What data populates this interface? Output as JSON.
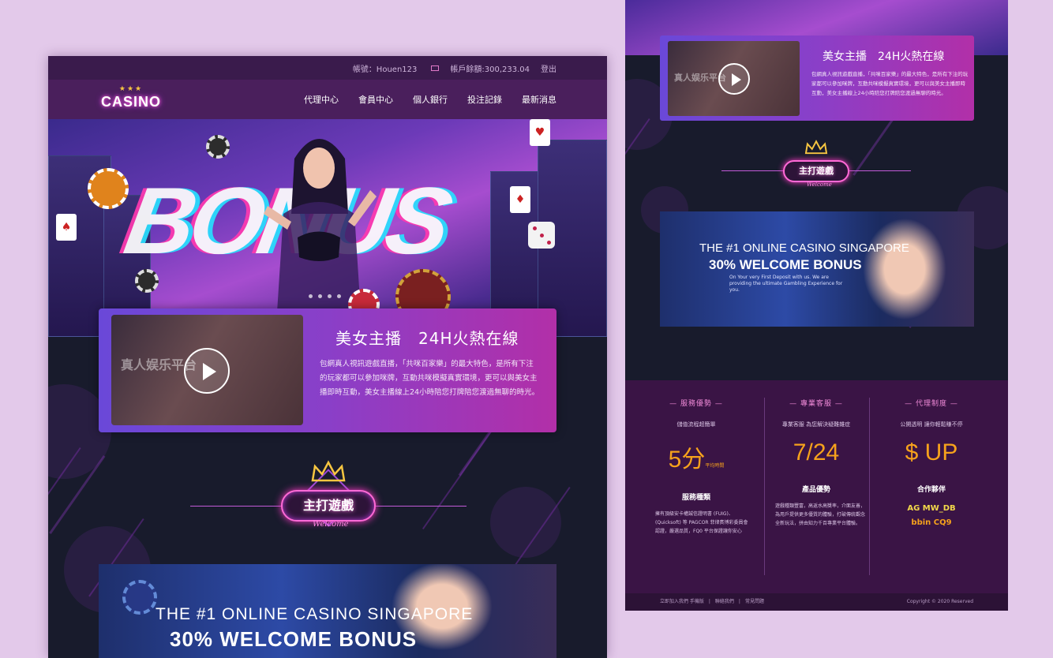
{
  "left": {
    "topbar": {
      "account": "帳號：Houen123",
      "balance": "帳戶餘額:300,233.04",
      "logout": "登出"
    },
    "logo": {
      "stars": "★★★",
      "word": "CASINO"
    },
    "nav": [
      "代理中心",
      "會員中心",
      "個人銀行",
      "投注記錄",
      "最新消息"
    ],
    "hero": {
      "bigtext": "BONUS"
    },
    "live": {
      "video_text": "真人娱乐平台",
      "title": "美女主播　24H火熱在線",
      "desc": "包網真人視訊遊戲直播，「共咪百家樂」的最大特色，是所有下注的玩家都可以參加咪牌，互動共咪模擬真實環境，更可以與美女主播即時互動，美女主播線上24小時陪您打牌陪您渡過無聊的時光。"
    },
    "section": {
      "title": "主打遊戲",
      "welcome": "Welcome"
    },
    "promo": {
      "line1": "THE #1 ONLINE CASINO SINGAPORE",
      "line2": "30% WELCOME BONUS"
    }
  },
  "right": {
    "live": {
      "video_text": "真人娱乐平台",
      "title": "美女主播　24H火熱在線",
      "desc": "包網真人視訊遊戲直播，「共咪百家樂」的最大特色，是所有下注的玩家都可以參加咪牌，互動共咪模擬真實環境，更可以與美女主播即時互動，美女主播線上24小時陪您打牌陪您渡過無聊的時光。"
    },
    "section": {
      "title": "主打遊戲",
      "welcome": "Welcome"
    },
    "promo": {
      "line1": "THE #1 ONLINE CASINO SINGAPORE",
      "line2": "30% WELCOME BONUS",
      "line3": "On Your very First Deposit with us. We are providing the ultimate Gambling Experience for you."
    },
    "features": [
      {
        "title": "— 服務優勢 —",
        "sub": "儲值流程超簡單",
        "big": "5分",
        "big_note": "平均時間",
        "head": "服務種類",
        "desc": "擁有頂級安卡權誠信證明書 (FUIG)、(Quicksoft) 等 PAGCOR 菲律賓博彩委員會認證，嚴選品質，FQ0 平台保證讓你安心"
      },
      {
        "title": "— 專業客服 —",
        "sub": "專業客服 為您解決疑難雜症",
        "big": "7/24",
        "big_note": "",
        "head": "產品優勢",
        "desc": "遊戲種類豐富，高返水高獎率，介面友善，為用戶提供更多優質的體驗，打破傳統觀念全新玩法，拼由知力千百專業平台體驗。"
      },
      {
        "title": "— 代理制度 —",
        "sub": "公開透明 讓你輕鬆賺不停",
        "big": "$ UP",
        "big_note": "",
        "head": "合作夥伴",
        "partners_1": "AG  MW_DB",
        "partners_2": "bbin  CQ9"
      }
    ],
    "footer": {
      "links": "立即加入我們 手機版　|　聯絡我們　|　常見問題",
      "copyright": "Copyright © 2020 Reserved"
    }
  }
}
